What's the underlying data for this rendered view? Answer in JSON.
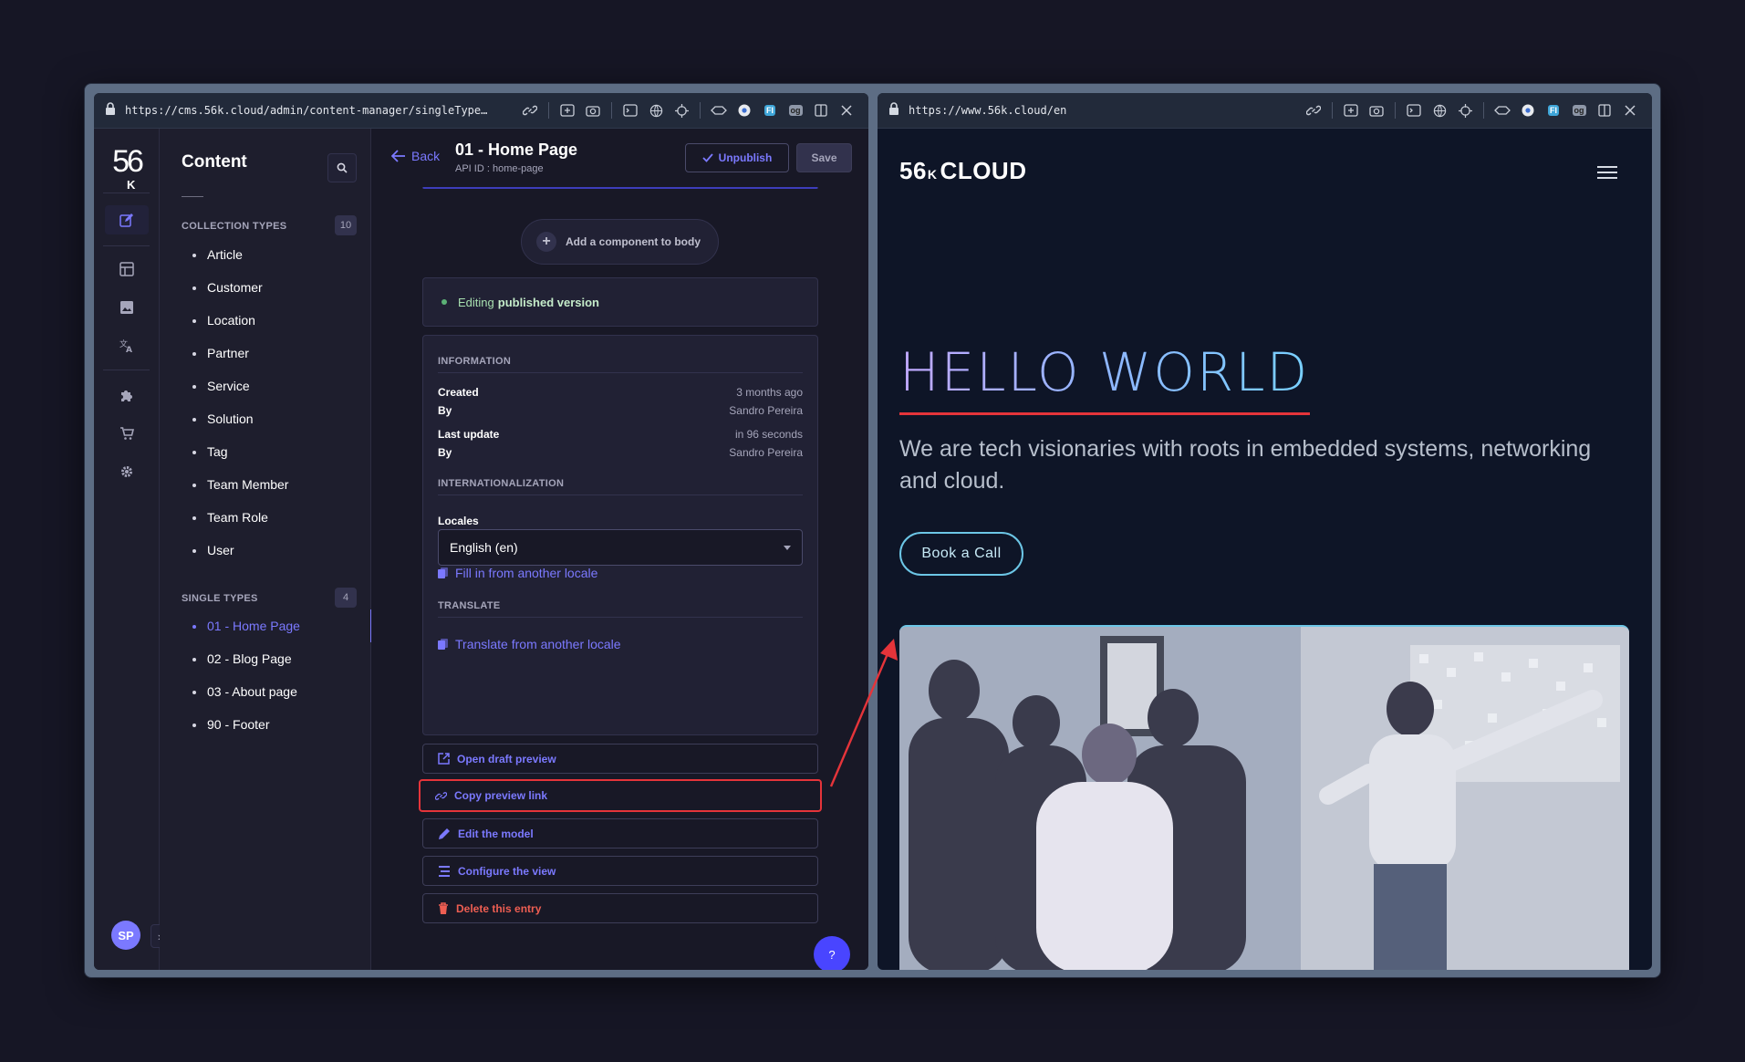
{
  "left_window": {
    "url": "https://cms.56k.cloud/admin/content-manager/singleType/api::...",
    "nav": {
      "logo_main": "56",
      "logo_sub": "K",
      "avatar_initials": "SP"
    },
    "subnav": {
      "title": "Content",
      "collection_types_label": "COLLECTION TYPES",
      "collection_types_count": "10",
      "collection_types": [
        "Article",
        "Customer",
        "Location",
        "Partner",
        "Service",
        "Solution",
        "Tag",
        "Team Member",
        "Team Role",
        "User"
      ],
      "single_types_label": "SINGLE TYPES",
      "single_types_count": "4",
      "single_types": [
        "01 - Home Page",
        "02 - Blog Page",
        "03 - About page",
        "90 - Footer"
      ],
      "active_single_type": "01 - Home Page"
    },
    "header": {
      "back_label": "Back",
      "title": "01 - Home Page",
      "api_id": "API ID : home-page",
      "unpublish_label": "Unpublish",
      "save_label": "Save"
    },
    "add_component_label": "Add a component to body",
    "editing_status": {
      "prefix": "Editing",
      "state": "published version"
    },
    "information": {
      "heading": "INFORMATION",
      "created_label": "Created",
      "created_value": "3 months ago",
      "created_by_label": "By",
      "created_by_value": "Sandro Pereira",
      "last_update_label": "Last update",
      "last_update_value": "in 96 seconds",
      "updated_by_label": "By",
      "updated_by_value": "Sandro Pereira"
    },
    "internationalization": {
      "heading": "INTERNATIONALIZATION",
      "locales_label": "Locales",
      "locale_selected": "English (en)",
      "fill_from_locale": "Fill in from another locale"
    },
    "translate": {
      "heading": "TRANSLATE",
      "translate_from_locale": "Translate from another locale"
    },
    "actions": {
      "open_draft_preview": "Open draft preview",
      "copy_preview_link": "Copy preview link",
      "edit_model": "Edit the model",
      "configure_view": "Configure the view",
      "delete_entry": "Delete this entry"
    },
    "help_label": "?"
  },
  "right_window": {
    "url": "https://www.56k.cloud/en",
    "logo_main": "56",
    "logo_k": "K",
    "logo_word": "CLOUD",
    "hero_title": "HELLO WORLD",
    "hero_subtitle": "We are tech visionaries with roots in embedded systems, networking and cloud.",
    "cta_label": "Book a Call"
  },
  "colors": {
    "accent": "#7b79ff",
    "danger": "#ee5e52",
    "highlight_red": "#e5343a",
    "success": "#5cb176",
    "site_cta": "#6cc6e6"
  }
}
